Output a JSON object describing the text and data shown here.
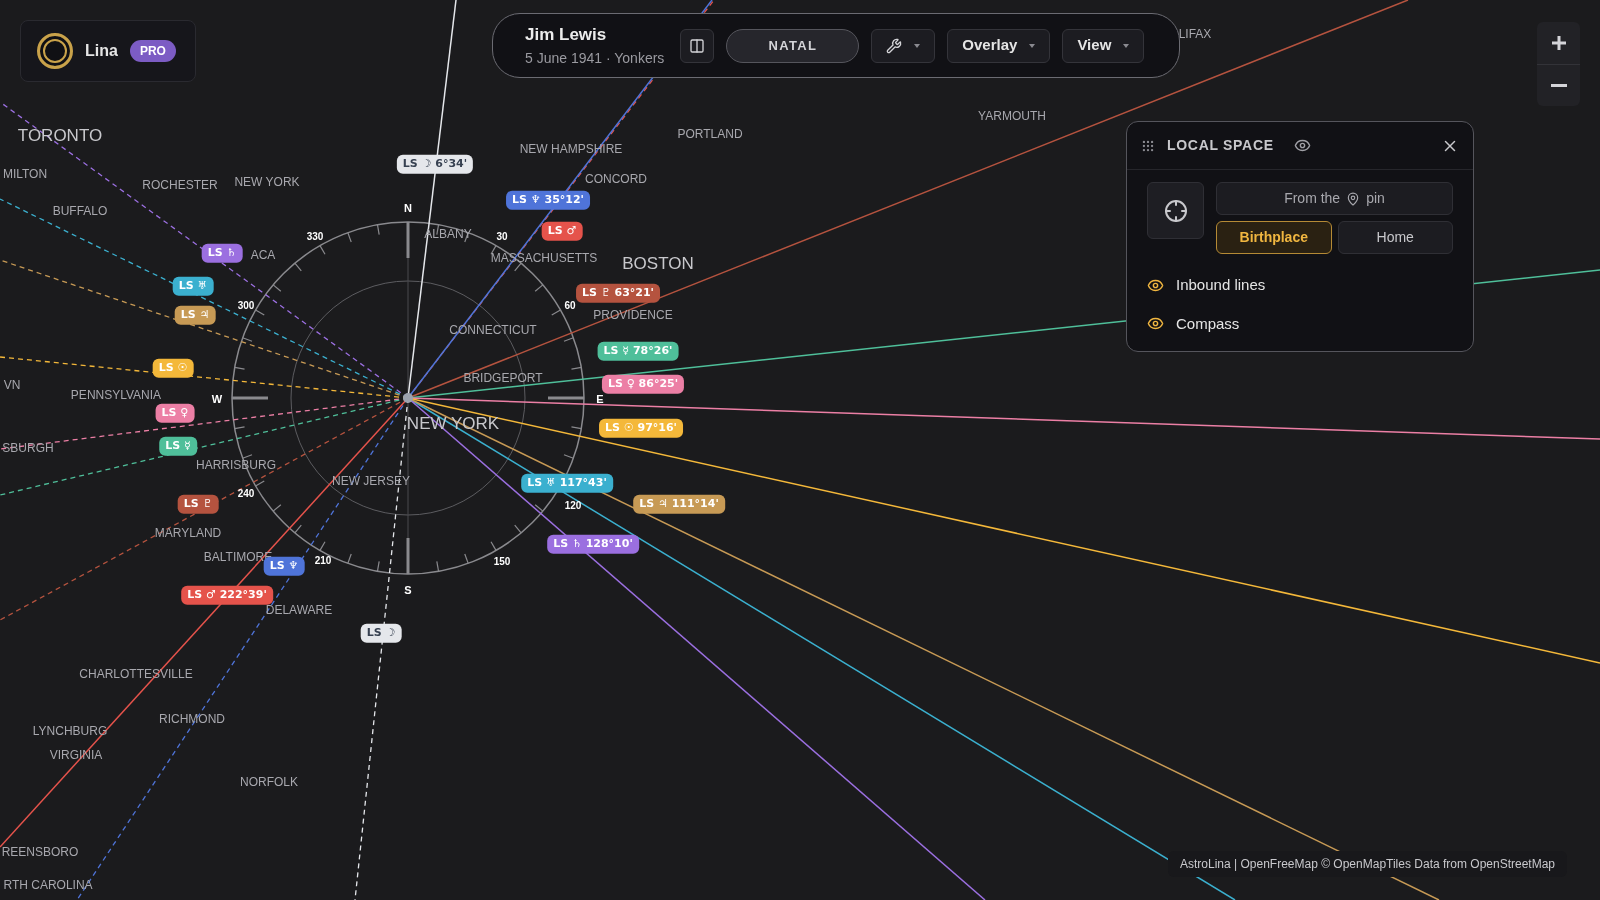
{
  "brand": {
    "name": "Lina",
    "badge": "PRO"
  },
  "header": {
    "name": "Jim Lewis",
    "subtitle": "5 June 1941 · Yonkers",
    "mode": "NATAL",
    "menus": [
      {
        "label": "Overlay"
      },
      {
        "label": "View"
      }
    ]
  },
  "panel": {
    "title": "LOCAL SPACE",
    "origin_prefix": "From the",
    "origin_suffix": "pin",
    "options": [
      {
        "label": "Birthplace",
        "selected": true
      },
      {
        "label": "Home",
        "selected": false
      }
    ],
    "toggles": [
      {
        "label": "Inbound lines",
        "on": true
      },
      {
        "label": "Compass",
        "on": true
      }
    ]
  },
  "compass": {
    "cardinals": [
      "N",
      "E",
      "S",
      "W"
    ],
    "degrees": [
      "30",
      "60",
      "120",
      "150",
      "210",
      "240",
      "300",
      "330"
    ]
  },
  "outbound_tags": [
    {
      "color": "#e5e7eb",
      "label": "LS ☽ 6°34'"
    },
    {
      "color": "#4f74d9",
      "label": "LS ♆ 35°12'"
    },
    {
      "color": "#b5533f",
      "label": "LS ♇ 63°21'"
    },
    {
      "color": "#4fbf9a",
      "label": "LS ☿ 78°26'"
    },
    {
      "color": "#ec7fa5",
      "label": "LS ♀ 86°25'"
    },
    {
      "color": "#f4b83a",
      "label": "LS ☉ 97°16'"
    },
    {
      "color": "#3bb0cf",
      "label": "LS ♅ 117°43'"
    },
    {
      "color": "#c79a55",
      "label": "LS ♃ 111°14'"
    },
    {
      "color": "#9b6fe0",
      "label": "LS ♄ 128°10'"
    },
    {
      "color": "#e5534b",
      "label": "LS ♂ 222°39'"
    }
  ],
  "inbound_tags": [
    {
      "color": "#e5534b",
      "label": "LS ♂"
    },
    {
      "color": "#9b6fe0",
      "label": "LS ♄"
    },
    {
      "color": "#3bb0cf",
      "label": "LS ♅"
    },
    {
      "color": "#c79a55",
      "label": "LS ♃"
    },
    {
      "color": "#f4b83a",
      "label": "LS ☉"
    },
    {
      "color": "#ec7fa5",
      "label": "LS ♀"
    },
    {
      "color": "#4fbf9a",
      "label": "LS ☿"
    },
    {
      "color": "#b5533f",
      "label": "LS ♇"
    },
    {
      "color": "#4f74d9",
      "label": "LS ♆"
    },
    {
      "color": "#e5e7eb",
      "label": "LS ☽"
    }
  ],
  "places": [
    {
      "name": "TORONTO",
      "kind": "major"
    },
    {
      "name": "MILTON",
      "kind": "city"
    },
    {
      "name": "ROCHESTER",
      "kind": "city"
    },
    {
      "name": "NEW YORK",
      "kind": "city"
    },
    {
      "name": "BUFFALO",
      "kind": "city"
    },
    {
      "name": "ACA",
      "kind": "city"
    },
    {
      "name": "ALBANY",
      "kind": "city"
    },
    {
      "name": "NEW HAMPSHIRE",
      "kind": "city"
    },
    {
      "name": "CONCORD",
      "kind": "city"
    },
    {
      "name": "PORTLAND",
      "kind": "city"
    },
    {
      "name": "YARMOUTH",
      "kind": "city"
    },
    {
      "name": "LIFAX",
      "kind": "city"
    },
    {
      "name": "MASSACHUSETTS",
      "kind": "city"
    },
    {
      "name": "BOSTON",
      "kind": "major"
    },
    {
      "name": "PROVIDENCE",
      "kind": "city"
    },
    {
      "name": "CONNECTICUT",
      "kind": "city"
    },
    {
      "name": "BRIDGEPORT",
      "kind": "city"
    },
    {
      "name": "NEW YORK",
      "kind": "major"
    },
    {
      "name": "PENNSYLVANIA",
      "kind": "city"
    },
    {
      "name": "VN",
      "kind": "city"
    },
    {
      "name": "SBURGH",
      "kind": "city"
    },
    {
      "name": "HARRISBURG",
      "kind": "city"
    },
    {
      "name": "NEW JERSEY",
      "kind": "city"
    },
    {
      "name": "MARYLAND",
      "kind": "city"
    },
    {
      "name": "BALTIMORE",
      "kind": "city"
    },
    {
      "name": "DELAWARE",
      "kind": "city"
    },
    {
      "name": "CHARLOTTESVILLE",
      "kind": "city"
    },
    {
      "name": "RICHMOND",
      "kind": "city"
    },
    {
      "name": "LYNCHBURG",
      "kind": "city"
    },
    {
      "name": "VIRGINIA",
      "kind": "city"
    },
    {
      "name": "NORFOLK",
      "kind": "city"
    },
    {
      "name": "REENSBORO",
      "kind": "city"
    },
    {
      "name": "RTH CAROLINA",
      "kind": "city"
    }
  ],
  "attribution": "AstroLina | OpenFreeMap © OpenMapTiles Data from OpenStreetMap"
}
